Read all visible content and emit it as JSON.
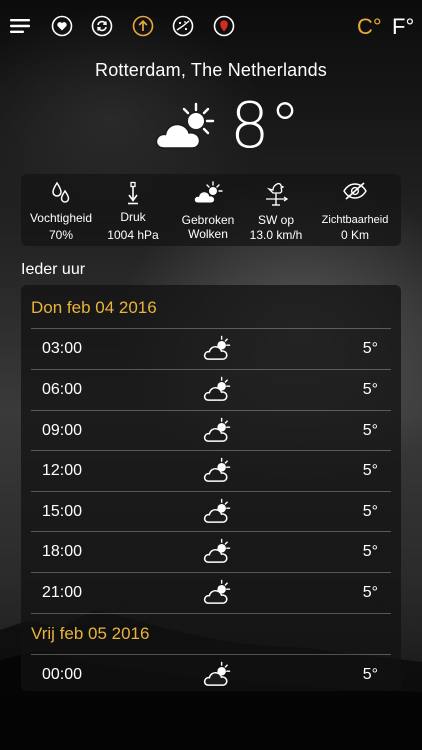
{
  "topbar": {
    "icons": [
      "menu-icon",
      "favorites-icon",
      "refresh-icon",
      "upload-icon",
      "radar-icon",
      "map-pin-icon"
    ],
    "unit_c": "C°",
    "unit_f": "F°",
    "accent_color": "#e8a93b"
  },
  "location": "Rotterdam, The Netherlands",
  "current": {
    "temperature": "8°",
    "condition_icon": "partly-cloudy-icon"
  },
  "stats": [
    {
      "icon": "humidity-icon",
      "label": "Vochtigheid",
      "value": "70%"
    },
    {
      "icon": "pressure-icon",
      "label": "Druk",
      "value": "1004 hPa"
    },
    {
      "icon": "broken-clouds-icon",
      "label": "Gebroken",
      "value": "Wolken"
    },
    {
      "icon": "wind-vane-icon",
      "label": "SW op",
      "value": "13.0 km/h"
    },
    {
      "icon": "visibility-icon",
      "label": "Zichtbaarheid",
      "value": "0 Km"
    }
  ],
  "section_title": "Ieder uur",
  "days": [
    {
      "label": "Don feb 04 2016",
      "hours": [
        {
          "time": "03:00",
          "temp": "5°"
        },
        {
          "time": "06:00",
          "temp": "5°"
        },
        {
          "time": "09:00",
          "temp": "5°"
        },
        {
          "time": "12:00",
          "temp": "5°"
        },
        {
          "time": "15:00",
          "temp": "5°"
        },
        {
          "time": "18:00",
          "temp": "5°"
        },
        {
          "time": "21:00",
          "temp": "5°"
        }
      ]
    },
    {
      "label": "Vrij feb 05 2016",
      "hours": [
        {
          "time": "00:00",
          "temp": "5°"
        }
      ]
    }
  ]
}
